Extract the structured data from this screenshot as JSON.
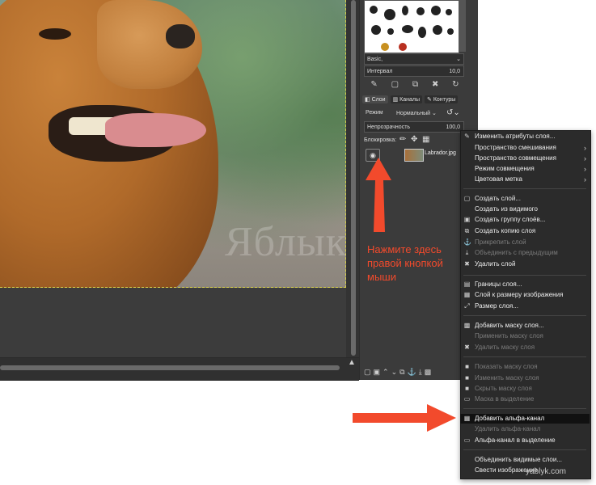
{
  "canvas": {
    "watermark": "Яблык"
  },
  "brushes": {
    "name": "Basic,",
    "spacing_label": "Интервал",
    "spacing_value": "10,0"
  },
  "layers_panel": {
    "tabs": [
      {
        "label": "Слои",
        "active": true
      },
      {
        "label": "Каналы",
        "active": false
      },
      {
        "label": "Контуры",
        "active": false
      }
    ],
    "mode_label": "Режим",
    "mode_value": "Нормальный",
    "opacity_label": "Непрозрачность",
    "opacity_value": "100,0",
    "lock_label": "Блокировка:",
    "layer_name": "Labrador.jpg"
  },
  "context_menu": {
    "items": [
      {
        "label": "Изменить атрибуты слоя...",
        "icon": "edit-icon",
        "disabled": false,
        "submenu": false,
        "highlighted": false
      },
      {
        "label": "Пространство смешивания",
        "icon": "",
        "disabled": false,
        "submenu": true,
        "highlighted": false
      },
      {
        "label": "Пространство совмещения",
        "icon": "",
        "disabled": false,
        "submenu": true,
        "highlighted": false
      },
      {
        "label": "Режим совмещения",
        "icon": "",
        "disabled": false,
        "submenu": true,
        "highlighted": false
      },
      {
        "label": "Цветовая метка",
        "icon": "",
        "disabled": false,
        "submenu": true,
        "highlighted": false
      },
      {
        "label": "Создать слой...",
        "icon": "new-layer-icon",
        "disabled": false,
        "submenu": false,
        "highlighted": false
      },
      {
        "label": "Создать из видимого",
        "icon": "",
        "disabled": false,
        "submenu": false,
        "highlighted": false
      },
      {
        "label": "Создать группу слоёв...",
        "icon": "layer-group-icon",
        "disabled": false,
        "submenu": false,
        "highlighted": false
      },
      {
        "label": "Создать копию слоя",
        "icon": "duplicate-icon",
        "disabled": false,
        "submenu": false,
        "highlighted": false
      },
      {
        "label": "Прикрепить слой",
        "icon": "anchor-icon",
        "disabled": true,
        "submenu": false,
        "highlighted": false
      },
      {
        "label": "Объединить с предыдущим",
        "icon": "merge-down-icon",
        "disabled": true,
        "submenu": false,
        "highlighted": false
      },
      {
        "label": "Удалить слой",
        "icon": "delete-icon",
        "disabled": false,
        "submenu": false,
        "highlighted": false
      },
      {
        "label": "Границы слоя...",
        "icon": "layer-boundary-icon",
        "disabled": false,
        "submenu": false,
        "highlighted": false
      },
      {
        "label": "Слой к размеру изображения",
        "icon": "layer-to-image-size-icon",
        "disabled": false,
        "submenu": false,
        "highlighted": false
      },
      {
        "label": "Размер слоя...",
        "icon": "scale-layer-icon",
        "disabled": false,
        "submenu": false,
        "highlighted": false
      },
      {
        "label": "Добавить маску слоя...",
        "icon": "add-mask-icon",
        "disabled": false,
        "submenu": false,
        "highlighted": false
      },
      {
        "label": "Применить маску слоя",
        "icon": "",
        "disabled": true,
        "submenu": false,
        "highlighted": false
      },
      {
        "label": "Удалить маску слоя",
        "icon": "delete-mask-icon",
        "disabled": true,
        "submenu": false,
        "highlighted": false
      },
      {
        "label": "Показать маску слоя",
        "icon": "checkbox-icon",
        "disabled": true,
        "submenu": false,
        "highlighted": false
      },
      {
        "label": "Изменить маску слоя",
        "icon": "checkbox-icon",
        "disabled": true,
        "submenu": false,
        "highlighted": false
      },
      {
        "label": "Скрыть маску слоя",
        "icon": "checkbox-icon",
        "disabled": true,
        "submenu": false,
        "highlighted": false
      },
      {
        "label": "Маска в выделение",
        "icon": "mask-to-selection-icon",
        "disabled": true,
        "submenu": false,
        "highlighted": false
      },
      {
        "label": "Добавить альфа-канал",
        "icon": "alpha-channel-icon",
        "disabled": false,
        "submenu": false,
        "highlighted": true
      },
      {
        "label": "Удалить альфа-канал",
        "icon": "",
        "disabled": true,
        "submenu": false,
        "highlighted": false
      },
      {
        "label": "Альфа-канал в выделение",
        "icon": "alpha-to-selection-icon",
        "disabled": false,
        "submenu": false,
        "highlighted": false
      },
      {
        "label": "Объединить видимые слои...",
        "icon": "",
        "disabled": false,
        "submenu": false,
        "highlighted": false
      },
      {
        "label": "Свести изображение",
        "icon": "",
        "disabled": false,
        "submenu": false,
        "highlighted": false
      }
    ]
  },
  "annotation": {
    "text": "Нажмите здесь правой кнопкой мыши",
    "color": "#f24a2c"
  },
  "credit": "yablyk.com",
  "colors": {
    "accent": "#f24a2c",
    "menu_bg": "#2b2b2b",
    "panel_bg": "#3b3b3b"
  }
}
